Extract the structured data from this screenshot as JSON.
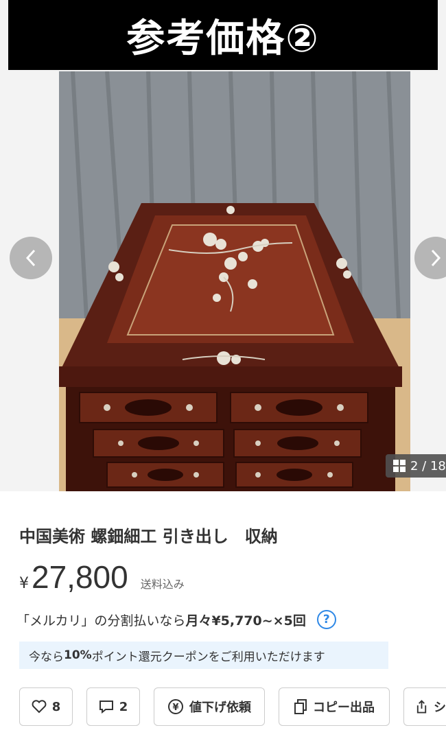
{
  "banner": {
    "text": "参考価格②"
  },
  "gallery": {
    "counter": "2 / 18"
  },
  "product": {
    "title": "中国美術 螺鈿細工 引き出し　収納",
    "currency": "¥",
    "price": "27,800",
    "shipping": "送料込み"
  },
  "installment": {
    "prefix": "「メルカリ」の分割払いなら",
    "amount": "月々¥5,770~×5回"
  },
  "coupon": {
    "prefix": "今なら ",
    "rate": "10%",
    "suffix": " ポイント還元クーポンをご利用いただけます"
  },
  "actions": {
    "likes": "8",
    "comments": "2",
    "price_down": "値下げ依頼",
    "copy": "コピー出品",
    "share": "シ"
  },
  "colors": {
    "accent": "#2e88e6",
    "coupon_bg": "#eaf4fd"
  }
}
